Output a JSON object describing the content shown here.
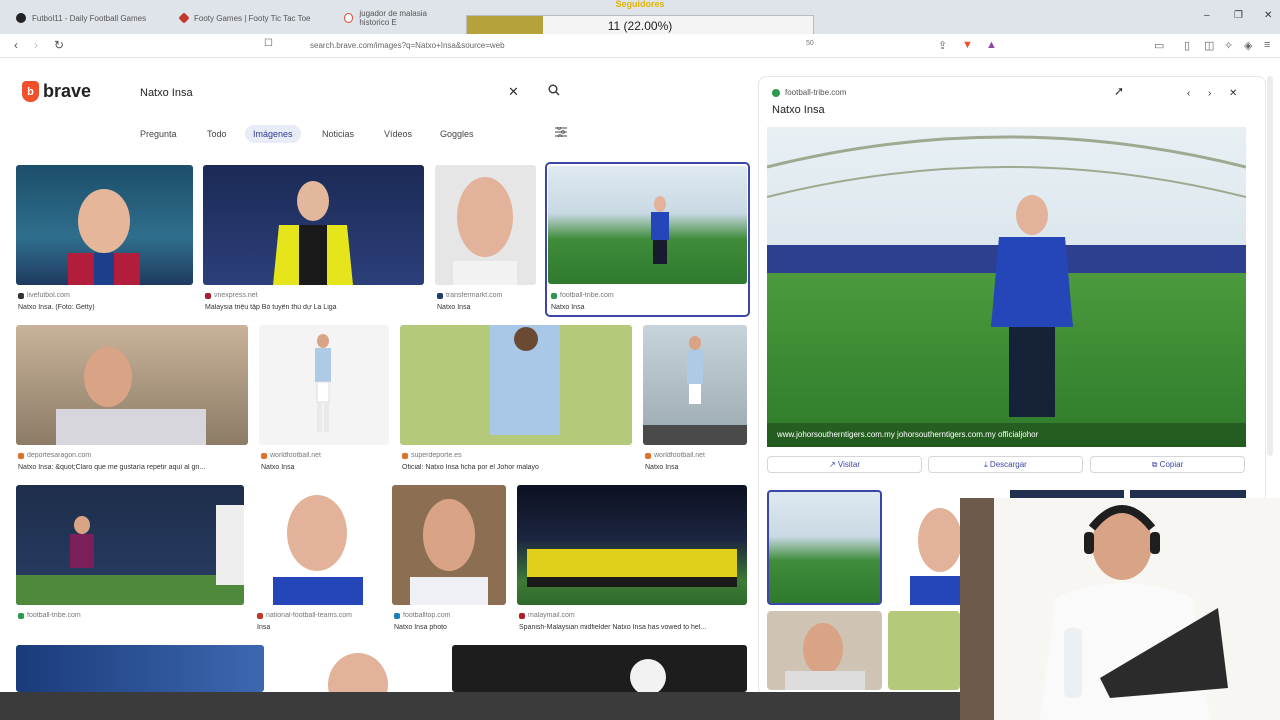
{
  "browser": {
    "tabs": [
      {
        "label": "Futbol11 - Daily Football Games",
        "color": "#222"
      },
      {
        "label": "Footy Games | Footy Tic Tac Toe",
        "color": "#c0392b"
      },
      {
        "label": "jugador de malasia historico E",
        "color": "#e74c3c"
      }
    ],
    "url": "search.brave.com/images?q=Natxo+Insa&source=web",
    "zoom": "50",
    "window_controls": {
      "minimize": "–",
      "maximize": "❐",
      "close": "✕"
    }
  },
  "overlay": {
    "label": "Seguidores",
    "text": "11 (22.00%)",
    "progress": 0.22
  },
  "search": {
    "logo": "brave",
    "query": "Natxo Insa",
    "tabs": [
      "Pregunta",
      "Todo",
      "Imágenes",
      "Noticias",
      "Vídeos",
      "Goggles"
    ],
    "active_tab": "Imágenes"
  },
  "results": [
    {
      "source": "livefutbol.com",
      "caption": "Natxo Insa. (Foto: Getty)",
      "icon_color": "#333"
    },
    {
      "source": "vnexpress.net",
      "caption": "Malaysia triệu tập Bỏ tuyển thủ dự La Liga",
      "icon_color": "#a32035"
    },
    {
      "source": "transfermarkt.com",
      "caption": "Natxo Insa",
      "icon_color": "#1f3a6b"
    },
    {
      "source": "football-tribe.com",
      "caption": "Natxo Insa",
      "icon_color": "#2e9a4e"
    },
    {
      "source": "deportesaragon.com",
      "caption": "Natxo Insa: &quot;Claro que me gustaría repetir aquí al gri...",
      "icon_color": "#e0712a"
    },
    {
      "source": "worldfootball.net",
      "caption": "Natxo Insa",
      "icon_color": "#e0712a"
    },
    {
      "source": "superdeporte.es",
      "caption": "Oficial: Natxo Insa ficha por el Johor malayo",
      "icon_color": "#e0712a"
    },
    {
      "source": "worldfootball.net",
      "caption": "Natxo Insa",
      "icon_color": "#e0712a"
    },
    {
      "source": "football-tribe.com",
      "caption": "",
      "icon_color": "#2e9a4e"
    },
    {
      "source": "national-football-teams.com",
      "caption": "Insa",
      "icon_color": "#c0392b"
    },
    {
      "source": "footballtop.com",
      "caption": "Natxo Insa photo",
      "icon_color": "#1c7fb8"
    },
    {
      "source": "malaymail.com",
      "caption": "Spanish-Malaysian midfielder Natxo Insa has vowed to hel...",
      "icon_color": "#b01e2b"
    }
  ],
  "preview": {
    "source": "football-tribe.com",
    "title": "Natxo Insa",
    "buttons": {
      "visit": "Visitar",
      "download": "Descargar",
      "copy": "Copiar"
    },
    "banner_text": "www.johorsoutherntigers.com.my   johorsoutherntigers.com.my   officialjohor"
  },
  "icons": {
    "back": "‹",
    "forward": "›",
    "reload": "↻",
    "bookmark": "☐",
    "share": "⇪",
    "close": "✕",
    "search": "⌕",
    "filters": "☰"
  }
}
